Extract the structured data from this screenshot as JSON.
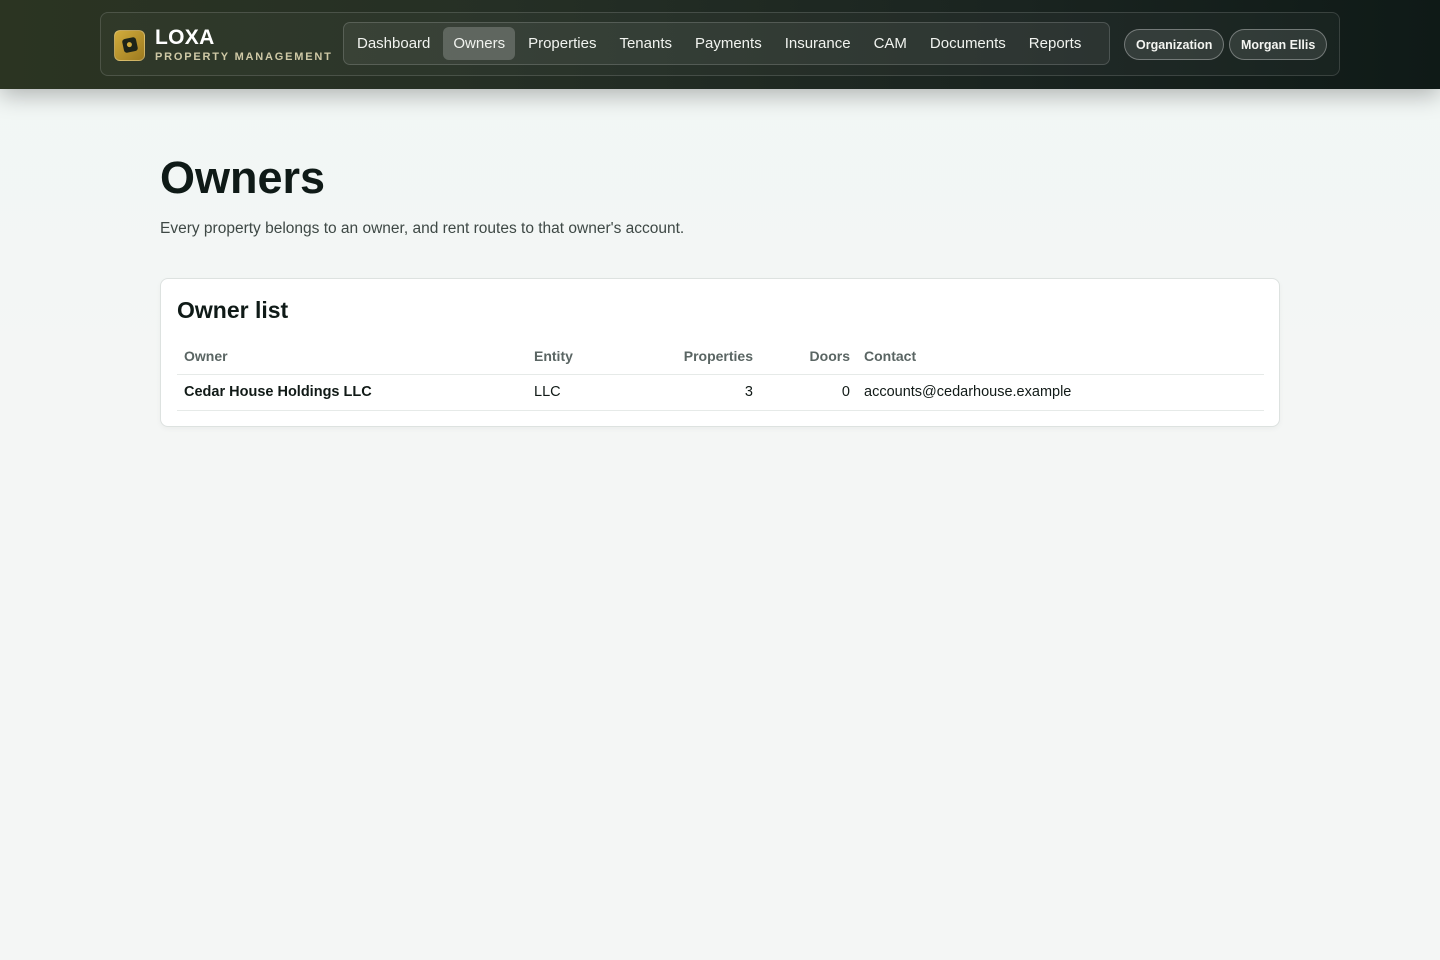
{
  "brand": {
    "name": "LOXA",
    "subtitle": "PROPERTY MANAGEMENT",
    "icon": "brand-logo-icon",
    "accent": "#d2ac3c"
  },
  "nav": {
    "items": [
      {
        "label": "Dashboard",
        "active": false
      },
      {
        "label": "Owners",
        "active": true
      },
      {
        "label": "Properties",
        "active": false
      },
      {
        "label": "Tenants",
        "active": false
      },
      {
        "label": "Payments",
        "active": false
      },
      {
        "label": "Insurance",
        "active": false
      },
      {
        "label": "CAM",
        "active": false
      },
      {
        "label": "Documents",
        "active": false
      },
      {
        "label": "Reports",
        "active": false
      }
    ]
  },
  "header": {
    "organization_label": "Organization",
    "user_label": "Morgan Ellis"
  },
  "page": {
    "title": "Owners",
    "subtitle": "Every property belongs to an owner, and rent routes to that owner's account."
  },
  "owner_list": {
    "title": "Owner list",
    "columns": {
      "owner": "Owner",
      "entity": "Entity",
      "properties": "Properties",
      "doors": "Doors",
      "contact": "Contact"
    },
    "rows": [
      {
        "owner": "Cedar House Holdings LLC",
        "entity": "LLC",
        "properties": "3",
        "doors": "0",
        "contact": "accounts@cedarhouse.example"
      }
    ]
  }
}
